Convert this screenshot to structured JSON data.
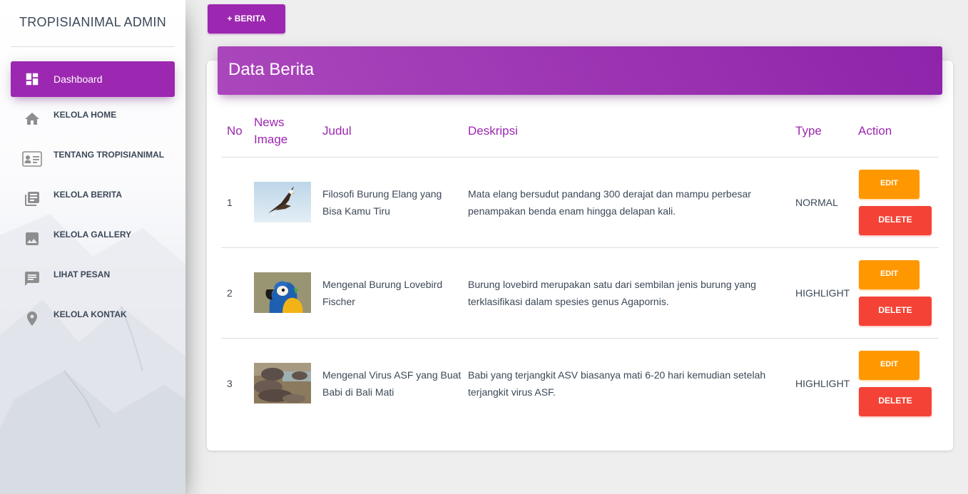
{
  "sidebar": {
    "brand": "TROPISIANIMAL ADMIN",
    "items": [
      {
        "label": "Dashboard",
        "icon": "dashboard-icon"
      },
      {
        "label": "KELOLA HOME",
        "icon": "home-icon"
      },
      {
        "label": "TENTANG TROPISIANIMAL",
        "icon": "id-card-icon"
      },
      {
        "label": "KELOLA BERITA",
        "icon": "library-books-icon"
      },
      {
        "label": "KELOLA GALLERY",
        "icon": "image-icon"
      },
      {
        "label": "LIHAT PESAN",
        "icon": "chat-icon"
      },
      {
        "label": "KELOLA KONTAK",
        "icon": "place-icon"
      }
    ]
  },
  "toolbar": {
    "add_label": "+ BERITA"
  },
  "card": {
    "title": "Data Berita",
    "columns": {
      "no": "No",
      "image_line1": "News",
      "image_line2": "Image",
      "judul": "Judul",
      "deskripsi": "Deskripsi",
      "type": "Type",
      "action": "Action"
    },
    "rows": [
      {
        "no": "1",
        "image": "eagle-image",
        "judul_line1": "Filosofi Burung Elang yang",
        "judul_line2": "Bisa Kamu Tiru",
        "desc_line1": "Mata elang bersudut pandang 300 derajat dan mampu perbesar",
        "desc_line2": "penampakan benda enam hingga delapan kali.",
        "type": "NORMAL",
        "edit": "EDIT",
        "delete": "DELETE"
      },
      {
        "no": "2",
        "image": "parrot-image",
        "judul_line1": "Mengenal Burung Lovebird",
        "judul_line2": "Fischer",
        "desc_line1": "Burung lovebird merupakan satu dari sembilan jenis burung yang",
        "desc_line2": "terklasifikasi dalam spesies genus Agapornis.",
        "type": "HIGHLIGHT",
        "edit": "EDIT",
        "delete": "DELETE"
      },
      {
        "no": "3",
        "image": "hippo-image",
        "judul_line1": "Mengenal Virus ASF yang Buat",
        "judul_line2": "Babi di Bali Mati",
        "desc_line1": "Babi yang terjangkit ASV biasanya mati 6-20 hari kemudian setelah",
        "desc_line2": "terjangkit virus ASF.",
        "type": "HIGHLIGHT",
        "edit": "EDIT",
        "delete": "DELETE"
      }
    ]
  },
  "colors": {
    "primary": "#9c27b0",
    "warning": "#ff9800",
    "danger": "#f44336",
    "background": "#eeeeee"
  }
}
